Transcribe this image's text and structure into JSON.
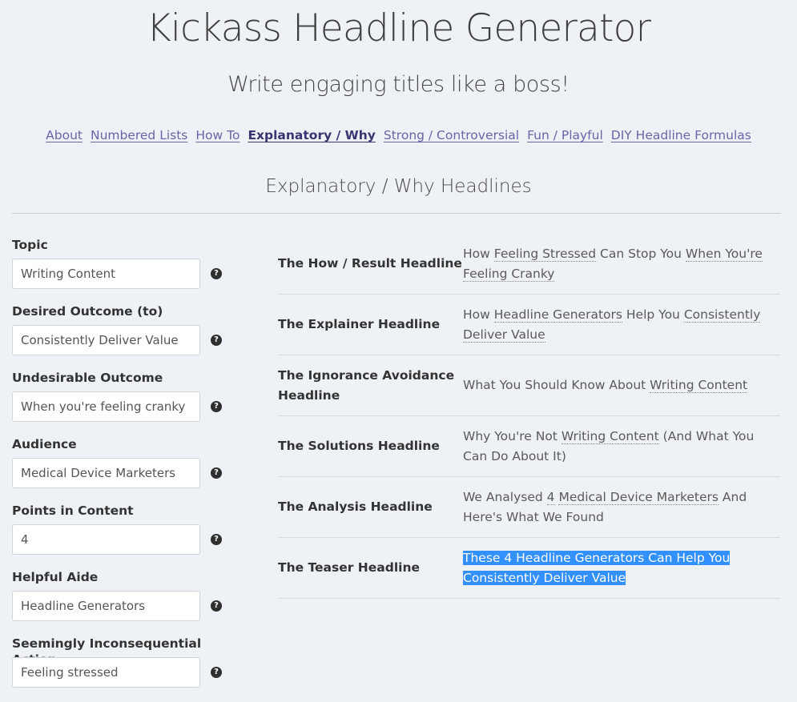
{
  "header": {
    "title": "Kickass Headline Generator",
    "tagline": "Write engaging titles like a boss!"
  },
  "nav": {
    "items": [
      {
        "label": "About",
        "active": false
      },
      {
        "label": "Numbered Lists",
        "active": false
      },
      {
        "label": "How To",
        "active": false
      },
      {
        "label": "Explanatory / Why",
        "active": true
      },
      {
        "label": "Strong / Controversial",
        "active": false
      },
      {
        "label": "Fun / Playful",
        "active": false
      },
      {
        "label": "DIY Headline Formulas",
        "active": false
      }
    ]
  },
  "section": {
    "title": "Explanatory / Why Headlines"
  },
  "form": {
    "fields": [
      {
        "label": "Topic",
        "value": "Writing Content"
      },
      {
        "label": "Desired Outcome (to)",
        "value": "Consistently Deliver Value"
      },
      {
        "label": "Undesirable Outcome",
        "value": "When you're feeling cranky"
      },
      {
        "label": "Audience",
        "value": "Medical Device Marketers"
      },
      {
        "label": "Points in Content",
        "value": "4"
      },
      {
        "label": "Helpful Aide",
        "value": "Headline Generators"
      },
      {
        "label": "Seemingly Inconsequential Action",
        "value": "Feeling stressed"
      }
    ],
    "help_glyph": "?",
    "help_icon": "question-circle-icon"
  },
  "headlines": [
    {
      "label": "The How / Result Headline",
      "parts": [
        {
          "t": "How "
        },
        {
          "t": "Feeling Stressed",
          "hl": true
        },
        {
          "t": " Can Stop You "
        },
        {
          "t": "When You're Feeling Cranky",
          "hl": true
        }
      ]
    },
    {
      "label": "The Explainer Headline",
      "parts": [
        {
          "t": "How "
        },
        {
          "t": "Headline Generators",
          "hl": true
        },
        {
          "t": " Help You "
        },
        {
          "t": "Consistently Deliver Value",
          "hl": true
        }
      ]
    },
    {
      "label": "The Ignorance Avoidance Headline",
      "parts": [
        {
          "t": "What You Should Know About "
        },
        {
          "t": "Writing Content",
          "hl": true
        }
      ]
    },
    {
      "label": "The Solutions Headline",
      "parts": [
        {
          "t": "Why You're Not "
        },
        {
          "t": "Writing Content",
          "hl": true
        },
        {
          "t": " (And What You Can Do About It)"
        }
      ]
    },
    {
      "label": "The Analysis Headline",
      "parts": [
        {
          "t": "We Analysed "
        },
        {
          "t": "4",
          "hl": true
        },
        {
          "t": " "
        },
        {
          "t": "Medical Device Marketers",
          "hl": true
        },
        {
          "t": " And Here's What We Found"
        }
      ]
    },
    {
      "label": "The Teaser Headline",
      "parts": [
        {
          "t": "These 4 Headline Generators Can Help You Consistently Deliver Value",
          "sel": true
        }
      ]
    }
  ],
  "colors": {
    "background": "#eef1f5",
    "nav_link": "#6b64a8",
    "nav_active": "#3a3470",
    "selection": "#3390ff"
  }
}
